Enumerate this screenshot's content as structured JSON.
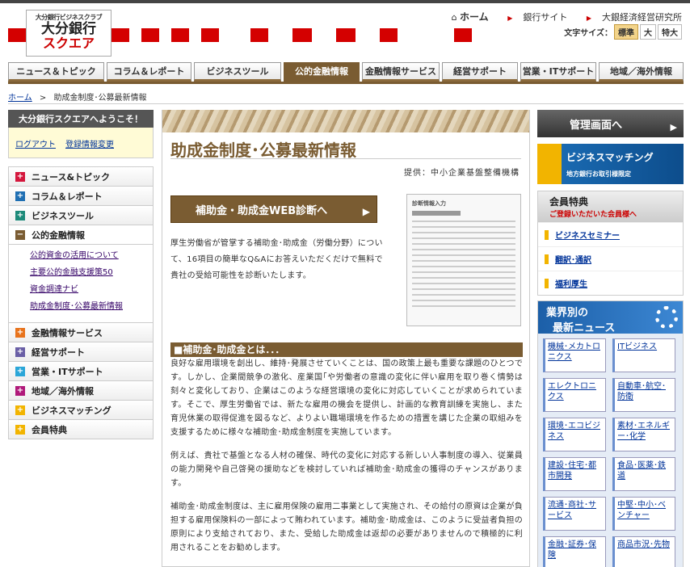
{
  "header": {
    "logo_line1": "大分銀行ビジネスクラブ",
    "logo_line2": "大分銀行",
    "logo_line3": "スクエア",
    "top_links": {
      "home": "ホーム",
      "bank_site": "銀行サイト",
      "institute": "大銀経済経営研究所"
    },
    "font_size_label": "文字サイズ：",
    "font_sizes": [
      "標準",
      "大",
      "特大"
    ]
  },
  "gnav": [
    "ニュース＆トピック",
    "コラム＆レポート",
    "ビジネスツール",
    "公的金融情報",
    "金融情報サービス",
    "経営サポート",
    "営業・ITサポート",
    "地域／海外情報"
  ],
  "breadcrumb": {
    "home": "ホーム",
    "sep": ">",
    "current": "助成金制度･公募最新情報"
  },
  "left": {
    "welcome_title": "大分銀行スクエアへようこそ！",
    "logout": "ログアウト",
    "account_change": "登録情報変更",
    "menu": [
      {
        "label": "ニュース&トピック",
        "color": "#d4163c",
        "sym": "+"
      },
      {
        "label": "コラム＆レポート",
        "color": "#1f6fb3",
        "sym": "+"
      },
      {
        "label": "ビジネスツール",
        "color": "#1d8a7a",
        "sym": "+"
      },
      {
        "label": "公的金融情報",
        "color": "#7a5c32",
        "sym": "−"
      }
    ],
    "submenu": [
      "公的資金の活用について",
      "主要公的金融支援策50",
      "資金調達ナビ",
      "助成金制度･公募最新情報"
    ],
    "menu2": [
      {
        "label": "金融情報サービス",
        "color": "#e8731c",
        "sym": "+"
      },
      {
        "label": "経営サポート",
        "color": "#6a5fa6",
        "sym": "+"
      },
      {
        "label": "営業・ITサポート",
        "color": "#2aa6d8",
        "sym": "+"
      },
      {
        "label": "地域／海外情報",
        "color": "#b0197a",
        "sym": "+"
      },
      {
        "label": "ビジネスマッチング",
        "color": "#f2b400",
        "sym": "+"
      },
      {
        "label": "会員特典",
        "color": "#f2b400",
        "sym": "+"
      }
    ]
  },
  "main": {
    "title": "助成金制度･公募最新情報",
    "provider": "提供：中小企業基盤整備機構",
    "diag_button": "補助金・助成金WEB診断へ",
    "diag_desc": "厚生労働省が管掌する補助金･助成金（労働分野）について、16項目の簡単なQ&Aにお答えいただくだけで無料で貴社の受給可能性を診断いたします。",
    "thumb_title": "診断情報入力",
    "section_title": "■補助金･助成金とは．．．",
    "paragraphs": [
      "良好な雇用環境を創出し、維持･発展させていくことは、国の政策上最も重要な課題のひとつです。しかし、企業間競争の激化、産業国｢や労働者の意識の変化に伴い雇用を取り巻く情勢は刻々と変化しており、企業はこのような経営環境の変化に対応していくことが求められています。そこで、厚生労働省では、新たな雇用の機会を提供し、計画的な教育訓練を実施し、また育児休業の取得促進を図るなど、よりよい職場環境を作るための措置を講じた企業の取組みを支援するために様々な補助金･助成金制度を実施しています。",
      "例えば、貴社で基盤となる人材の確保、時代の変化に対応する新しい人事制度の導入、従業員の能力開発や自己啓発の援助などを検討していれば補助金･助成金の獲得のチャンスがあります。",
      "補助金･助成金制度は、主に雇用保険の雇用二事業として実施され、その給付の原資は企業が負担する雇用保険料の一部によって賄われています。補助金･助成金は、このように受益者負担の原則により支給されており、また、受給した助成金は返却の必要がありませんので積極的に利用されることをお勧めします。"
    ]
  },
  "right": {
    "admin": "管理画面へ",
    "bm_title": "ビジネスマッチング",
    "bm_sub": "地方銀行お取引様限定",
    "member_title": "会員特典",
    "member_sub": "ご登録いただいた会員様へ",
    "member_items": [
      "ビジネスセミナー",
      "翻訳･通訳",
      "福利厚生"
    ],
    "industry_title1": "業界別の",
    "industry_title2": "最新ニュース",
    "industries": [
      "機械･メカトロニクス",
      "ITビジネス",
      "エレクトロニクス",
      "自動車･航空･防衛",
      "環境･エコビジネス",
      "素材･エネルギー･化学",
      "建設･住宅･都市開発",
      "食品･医薬･鉄道",
      "流通･商社･サービス",
      "中堅･中小･ベンチャー",
      "金融･証券･保険",
      "商品市況･先物"
    ]
  }
}
